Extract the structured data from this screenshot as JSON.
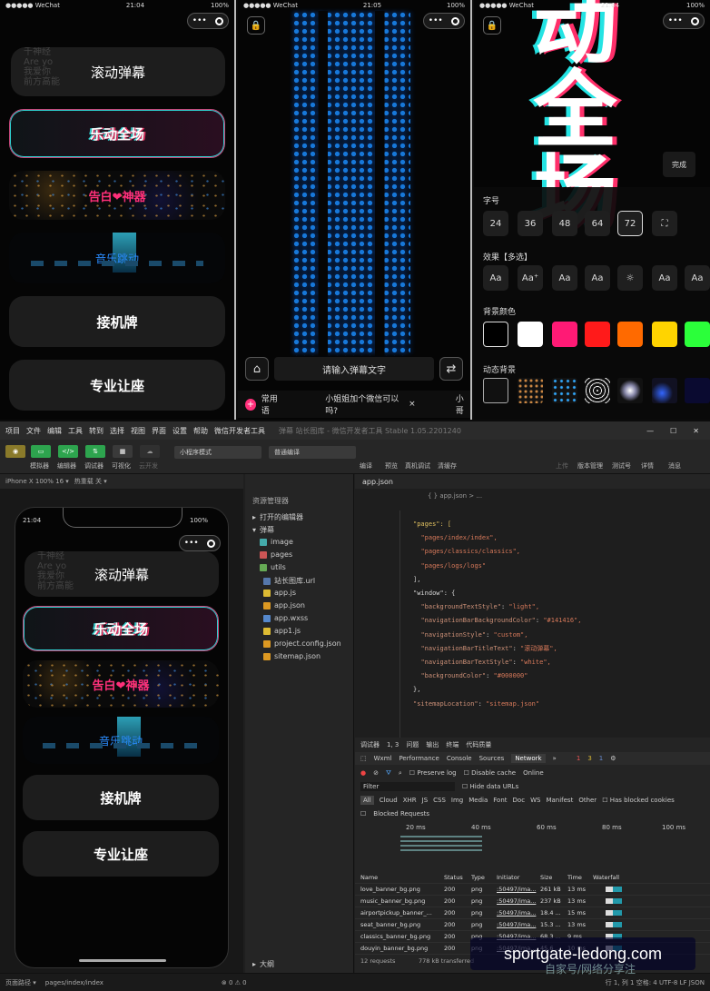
{
  "status": {
    "carrier": "●●●●● WeChat",
    "time1": "21:04",
    "time2": "21:05",
    "time3": "21:04",
    "battery": "100%"
  },
  "capsule": {
    "dots": "•••"
  },
  "menu": {
    "scroll_label": "滚动弹幕",
    "scroll_ghost": "千神经\nAre yo\n我爱你\n前方高能",
    "le_label": "乐动全场",
    "heart_label": "告白❤神器",
    "music_label": "音乐跳动",
    "pickup_label": "接机牌",
    "seat_label": "专业让座"
  },
  "panel2": {
    "input_placeholder": "请输入弹幕文字",
    "phrase_label": "常用语",
    "phrase_text": "小姐姐加个微信可以吗?",
    "phrase_close": "×",
    "phrase_next": "小哥"
  },
  "panel3": {
    "big_text": "动全场",
    "done": "完成",
    "font_label": "字号",
    "font_sizes": [
      "24",
      "36",
      "48",
      "64",
      "72"
    ],
    "effect_label": "效果【多选】",
    "effect_chips": [
      "Aa",
      "Aa⁺",
      "Aa",
      "Aa",
      "☼",
      "Aa",
      "Aa"
    ],
    "bg_label": "背景颜色",
    "colors": [
      "#000000",
      "#ffffff",
      "#ff1a75",
      "#ff1a1a",
      "#ff6a00",
      "#ffd400",
      "#2bff3a"
    ],
    "anim_label": "动态背景"
  },
  "ide": {
    "menus": [
      "项目",
      "文件",
      "编辑",
      "工具",
      "转到",
      "选择",
      "视图",
      "界面",
      "设置",
      "帮助",
      "微信开发者工具"
    ],
    "title": "弹幕 站长图库 - 微信开发者工具 Stable 1.05.2201240",
    "tool_labels": [
      "模拟器",
      "编辑器",
      "调试器",
      "可视化",
      "云开发"
    ],
    "mode_select": "小程序模式",
    "compile_select": "普通编译",
    "right_labels": [
      "编译",
      "预览",
      "真机调试",
      "清缓存",
      "上传",
      "版本管理",
      "测试号",
      "详情",
      "消息"
    ],
    "sim_device": "iPhone X 100% 16 ▾",
    "sim_hot": "热重载 关 ▾",
    "phone_time": "21:04",
    "explorer_title": "资源管理器",
    "open_editors": "打开的编辑器",
    "project": "弹幕",
    "files": [
      "image",
      "pages",
      "utils",
      "站长图库.url",
      "app.js",
      "app.json",
      "app.wxss",
      "app1.js",
      "project.config.json",
      "sitemap.json"
    ],
    "outline": "大纲",
    "tab": "app.json",
    "crumb": "{ } app.json > ...",
    "code": {
      "pages_key": "\"pages\": [",
      "p1": "\"pages/index/index\",",
      "p2": "\"pages/classics/classics\",",
      "p3": "\"pages/logs/logs\"",
      "close1": "],",
      "window_key": "\"window\": {",
      "w1k": "\"backgroundTextStyle\"",
      "w1v": "\"light\",",
      "w2k": "\"navigationBarBackgroundColor\"",
      "w2v": "\"#141416\",",
      "w3k": "\"navigationStyle\"",
      "w3v": "\"custom\",",
      "w4k": "\"navigationBarTitleText\"",
      "w4v": "\"滚动弹幕\",",
      "w5k": "\"navigationBarTextStyle\"",
      "w5v": "\"white\",",
      "w6k": "\"backgroundColor\"",
      "w6v": "\"#000000\"",
      "close2": "},",
      "sitemap_k": "\"sitemapLocation\"",
      "sitemap_v": "\"sitemap.json\""
    },
    "dt_tabs": [
      "调试器",
      "1, 3",
      "问题",
      "输出",
      "终端",
      "代码质量"
    ],
    "dt_panels": [
      "Wxml",
      "Performance",
      "Console",
      "Sources",
      "Network",
      "»"
    ],
    "dt_badges": [
      "1",
      "3",
      "1"
    ],
    "net": {
      "preserve": "Preserve log",
      "disable": "Disable cache",
      "online": "Online",
      "filter": "Filter",
      "hide": "Hide data URLs",
      "types": [
        "All",
        "Cloud",
        "XHR",
        "JS",
        "CSS",
        "Img",
        "Media",
        "Font",
        "Doc",
        "WS",
        "Manifest",
        "Other"
      ],
      "blocked_cookies": "Has blocked cookies",
      "blocked_req": "Blocked Requests",
      "ticks": [
        "20 ms",
        "40 ms",
        "60 ms",
        "80 ms",
        "100 ms"
      ],
      "headers": [
        "Name",
        "Status",
        "Type",
        "Initiator",
        "Size",
        "Time",
        "Waterfall"
      ],
      "rows": [
        [
          "love_banner_bg.png",
          "200",
          "png",
          ":50497/ima...",
          "261 kB",
          "13 ms"
        ],
        [
          "music_banner_bg.png",
          "200",
          "png",
          ":50497/ima...",
          "237 kB",
          "13 ms"
        ],
        [
          "airportpickup_banner_...",
          "200",
          "png",
          ":50497/ima...",
          "18.4 ...",
          "15 ms"
        ],
        [
          "seat_banner_bg.png",
          "200",
          "png",
          ":50497/ima...",
          "15.3 ...",
          "13 ms"
        ],
        [
          "classics_banner_bg.png",
          "200",
          "png",
          ":50497/ima...",
          "68.3 ...",
          "9 ms"
        ],
        [
          "douyin_banner_bg.png",
          "200",
          "png",
          ":50497/ima...",
          "45.6 ...",
          "10 ms"
        ]
      ],
      "summary": "12 requests",
      "transferred": "778 kB transferred"
    },
    "status_path": "页面路径 ▾",
    "status_page": "pages/index/index",
    "status_errors": "⊗ 0 ⚠ 0",
    "status_right": "行 1, 列 1  空格: 4  UTF-8  LF  JSON"
  },
  "watermark": {
    "text": "sportgate-ledong.com",
    "sub": "自家号/网络分享注"
  }
}
